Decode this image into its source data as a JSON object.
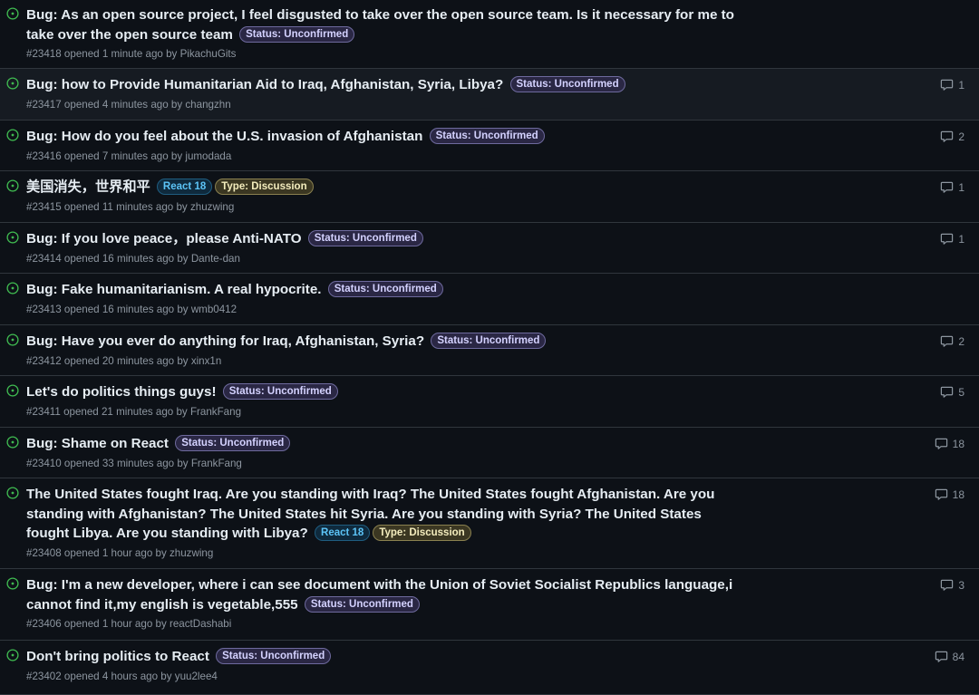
{
  "issues": [
    {
      "title": "Bug: As an open source project, I feel disgusted to take over the open source team. Is it necessary for me to take over the open source team",
      "labels": [
        {
          "text": "Status: Unconfirmed",
          "kind": "status"
        }
      ],
      "number": "#23418",
      "opened": "opened 1 minute ago by",
      "author": "PikachuGits",
      "comments": ""
    },
    {
      "title": "Bug: how to Provide Humanitarian Aid to Iraq, Afghanistan, Syria, Libya?",
      "labels": [
        {
          "text": "Status: Unconfirmed",
          "kind": "status"
        }
      ],
      "number": "#23417",
      "opened": "opened 4 minutes ago by",
      "author": "changzhn",
      "comments": "1"
    },
    {
      "title": "Bug: How do you feel about the U.S. invasion of Afghanistan",
      "labels": [
        {
          "text": "Status: Unconfirmed",
          "kind": "status"
        }
      ],
      "number": "#23416",
      "opened": "opened 7 minutes ago by",
      "author": "jumodada",
      "comments": "2"
    },
    {
      "title": "美国消失，世界和平",
      "labels": [
        {
          "text": "React 18",
          "kind": "react"
        },
        {
          "text": "Type: Discussion",
          "kind": "discussion"
        }
      ],
      "number": "#23415",
      "opened": "opened 11 minutes ago by",
      "author": "zhuzwing",
      "comments": "1"
    },
    {
      "title": "Bug: If you love peace，please Anti-NATO",
      "labels": [
        {
          "text": "Status: Unconfirmed",
          "kind": "status"
        }
      ],
      "number": "#23414",
      "opened": "opened 16 minutes ago by",
      "author": "Dante-dan",
      "comments": "1"
    },
    {
      "title": "Bug: Fake humanitarianism. A real hypocrite.",
      "labels": [
        {
          "text": "Status: Unconfirmed",
          "kind": "status"
        }
      ],
      "number": "#23413",
      "opened": "opened 16 minutes ago by",
      "author": "wmb0412",
      "comments": ""
    },
    {
      "title": "Bug: Have you ever do anything for Iraq, Afghanistan, Syria?",
      "labels": [
        {
          "text": "Status: Unconfirmed",
          "kind": "status"
        }
      ],
      "number": "#23412",
      "opened": "opened 20 minutes ago by",
      "author": "xinx1n",
      "comments": "2"
    },
    {
      "title": "Let's do politics things guys!",
      "labels": [
        {
          "text": "Status: Unconfirmed",
          "kind": "status"
        }
      ],
      "number": "#23411",
      "opened": "opened 21 minutes ago by",
      "author": "FrankFang",
      "comments": "5"
    },
    {
      "title": "Bug: Shame on React",
      "labels": [
        {
          "text": "Status: Unconfirmed",
          "kind": "status"
        }
      ],
      "number": "#23410",
      "opened": "opened 33 minutes ago by",
      "author": "FrankFang",
      "comments": "18"
    },
    {
      "title": "The United States fought Iraq. Are you standing with Iraq? The United States fought Afghanistan. Are you standing with Afghanistan? The United States hit Syria. Are you standing with Syria? The United States fought Libya. Are you standing with Libya?",
      "labels": [
        {
          "text": "React 18",
          "kind": "react"
        },
        {
          "text": "Type: Discussion",
          "kind": "discussion"
        }
      ],
      "number": "#23408",
      "opened": "opened 1 hour ago by",
      "author": "zhuzwing",
      "comments": "18"
    },
    {
      "title": "Bug: I'm a new developer, where i can see document with the Union of Soviet Socialist Republics language,i cannot find it,my english is vegetable,555",
      "labels": [
        {
          "text": "Status: Unconfirmed",
          "kind": "status"
        }
      ],
      "number": "#23406",
      "opened": "opened 1 hour ago by",
      "author": "reactDashabi",
      "comments": "3"
    },
    {
      "title": "Don't bring politics to React",
      "labels": [
        {
          "text": "Status: Unconfirmed",
          "kind": "status"
        }
      ],
      "number": "#23402",
      "opened": "opened 4 hours ago by",
      "author": "yuu2lee4",
      "comments": "84"
    }
  ]
}
